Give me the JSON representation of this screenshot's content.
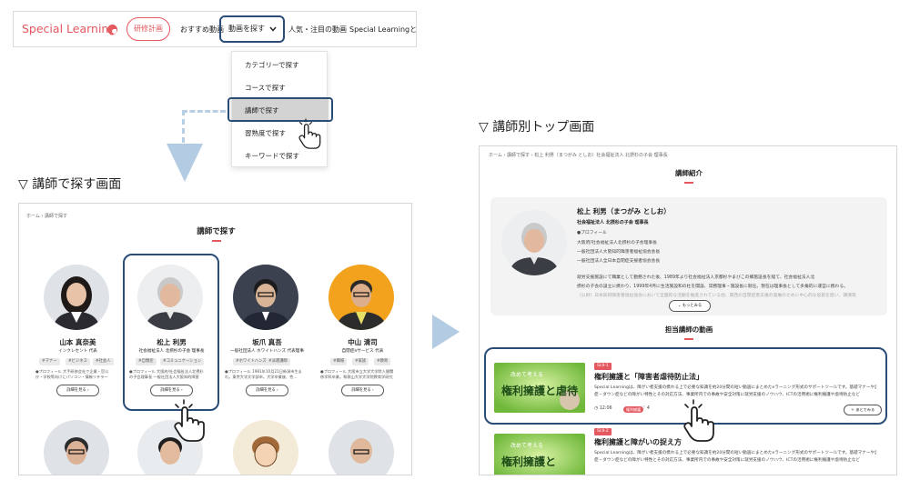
{
  "nav": {
    "logo": "Special Learning",
    "training": "研修計画",
    "recommended": "おすすめ動画",
    "search_videos": "動画を探す",
    "popular": "人気・注目の動画",
    "about": "Special Learningとは"
  },
  "dropdown": {
    "items": [
      "カテゴリーで探す",
      "コースで探す",
      "講師で探す",
      "習熟度で探す",
      "キーワードで探す"
    ]
  },
  "captions": {
    "left": "▽ 講師で探す画面",
    "right": "▽ 講師別トップ画面"
  },
  "left_screen": {
    "breadcrumb": [
      "ホーム",
      "講師で探す"
    ],
    "title": "講師で探す",
    "instructors": [
      {
        "name": "山本 真奈美",
        "org": "インクレセント 代表",
        "tags": [
          "#マナー",
          "#ビジネス",
          "#社会人"
        ],
        "desc": "●プロフィール 大手研修会社で企業・官公",
        "desc2": "庁・学校等向けにパソコン・情報リテラー",
        "button": "詳細を見る"
      },
      {
        "name": "松上 利男",
        "org": "社会福祉法人 北摂杉の子会 理事長",
        "tags": [
          "#自閉症",
          "#コミュニケーション"
        ],
        "desc": "●プロフィール 大阪府/社会福祉法人北摂杉",
        "desc2": "の子会理事長 一般社団法人大阪知的障害",
        "button": "詳細を見る"
      },
      {
        "name": "坂爪 真吾",
        "org": "一般社団法人 ホワイトハンズ 代表理事",
        "tags": [
          "#ホワイトハンズ",
          "#派遣講師"
        ],
        "desc": "●プロフィール 1981年10月21日新潟市生ま",
        "desc2": "れ。東京大学文学部卒。大学卒業後、性…",
        "button": "詳細を見る"
      },
      {
        "name": "中山 清司",
        "org": "自閉症eサービス 代表",
        "tags": [
          "#職場",
          "#家族",
          "#教育"
        ],
        "desc": "●プロフィール 大阪市立大学大学院人間関",
        "desc2": "係学科卒業。和歌山大学大学院教育学研究",
        "button": "詳細を見る"
      }
    ]
  },
  "right_screen": {
    "breadcrumb": [
      "ホーム",
      "講師で探す",
      "松上 利男（まつがみ としお）社会福祉法人 北摂杉の子会 理事長"
    ],
    "section_title": "講師紹介",
    "profile": {
      "name": "松上 利男（まつがみ としお）",
      "org": "社会福祉法人 北摂杉の子会 理事長",
      "label": "●プロフィール",
      "roles": [
        "大阪府/社会福祉法人北摂杉の子会理事長",
        "一般社団法人大阪知的障害者福祉協会会長",
        "一般社団法人全日本自閉症支援者協会会長"
      ],
      "bio1": "就労支援施設にて職業として勤務された後、1989年より社会福祉法人京都杉やまびこの郷施設長を経て、社会福祉法人北",
      "bio2": "摂杉の子会の設立に携わり、1999年4月に生活施設和の杜を開設、常務理事・施設長に就任。現在は理事長として多角的に運営に携わる。",
      "bio3": "（公財）日本知的障害者福祉協会において全国的な活動を推進されている他、関西の自閉症者支援の発展のために中心的な役割を担い、講演等",
      "more": "もっとみる"
    },
    "videos_title": "担当講師の動画",
    "videos": [
      {
        "badge": "SL9-1",
        "title": "権利擁護と「障害者虐待防止法」",
        "desc": "Special Learningは、障がい者支援の携わる上で必要な知識を約20分間の短い動画にまとめたeラーニング形式のサポートツールです。基礎マナーや自閉",
        "desc2": "症・ダウン症などの障がい特性とその対応方法、事業所内での事故や安全対策に就労支援のノウハウ、ICTの活用術に権利擁護や虐待防止など",
        "duration": "12:06",
        "tag": "権利擁護",
        "likes": "4",
        "thumb_top": "改めて考える",
        "thumb_main": "権利擁護と虐待",
        "fav": "あとでみる"
      },
      {
        "badge": "SL9-2",
        "title": "権利擁護と障がいの捉え方",
        "desc": "Special Learningは、障がい者支援の携わる上で必要な知識を約20分間の短い動画にまとめたeラーニング形式のサポートツールです。基礎マナーや自閉",
        "desc2": "症・ダウン症などの障がい特性とその対応方法、事業所内での事故や安全対策に就労支援のノウハウ、ICTの活用術に権利擁護や虐待防止など",
        "thumb_top": "改めて考える",
        "thumb_main": "権利擁護と"
      }
    ]
  },
  "colors": {
    "accent": "#e4585f",
    "highlight": "#2a4d78",
    "arrow": "#b3cce3",
    "thumb_green": "#8fcf4c"
  }
}
